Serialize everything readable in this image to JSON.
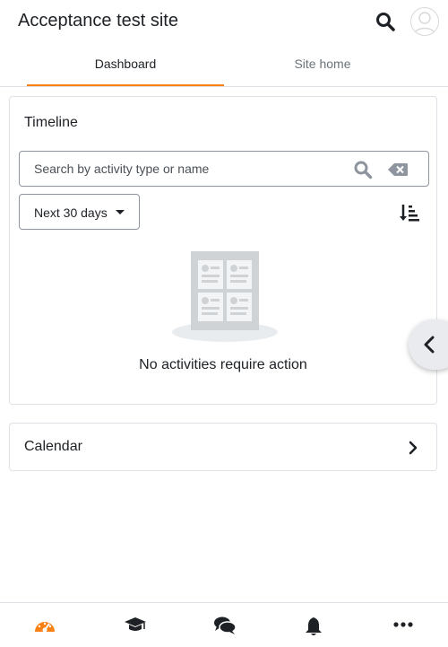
{
  "header": {
    "site_title": "Acceptance test site",
    "search_icon": "search-icon",
    "avatar_icon": "user-avatar-icon"
  },
  "tabs": [
    {
      "label": "Dashboard",
      "active": true
    },
    {
      "label": "Site home",
      "active": false
    }
  ],
  "timeline": {
    "title": "Timeline",
    "search": {
      "placeholder": "Search by activity type or name",
      "value": ""
    },
    "filter": {
      "selected": "Next 30 days"
    },
    "sort_icon": "sort-amount-down-icon",
    "empty_message": "No activities require action"
  },
  "calendar": {
    "title": "Calendar"
  },
  "bottom_nav": [
    {
      "icon": "dashboard-icon",
      "active": true
    },
    {
      "icon": "graduation-cap-icon",
      "active": false
    },
    {
      "icon": "messages-icon",
      "active": false
    },
    {
      "icon": "bell-icon",
      "active": false
    },
    {
      "icon": "more-icon",
      "active": false
    }
  ],
  "colors": {
    "accent": "#f98012",
    "text": "#1d2125",
    "muted": "#6a737b",
    "border": "#dee2e6",
    "icon_gray": "#8f959e"
  }
}
